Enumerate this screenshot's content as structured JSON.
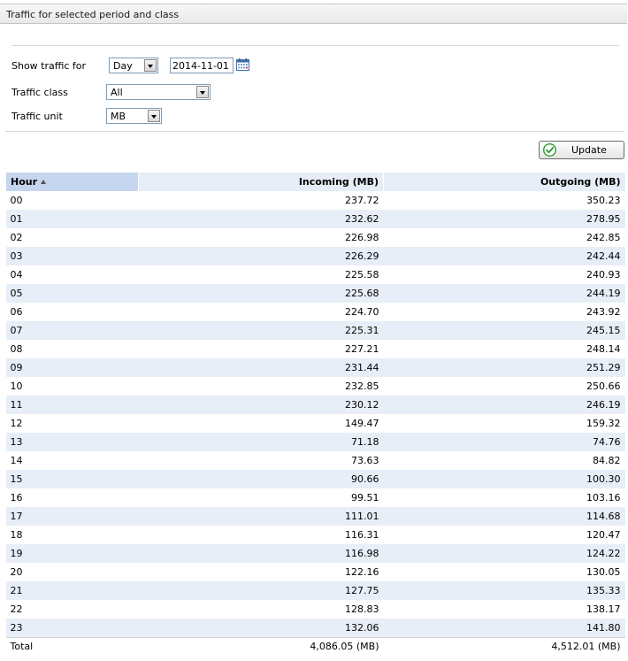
{
  "header": {
    "title": "Traffic for selected period and class"
  },
  "form": {
    "show_traffic_for": {
      "label": "Show traffic for",
      "period": "Day",
      "date": "2014-11-01"
    },
    "traffic_class": {
      "label": "Traffic class",
      "value": "All"
    },
    "traffic_unit": {
      "label": "Traffic unit",
      "value": "MB"
    }
  },
  "update_button": {
    "label": "Update"
  },
  "table": {
    "columns": [
      "Hour",
      "Incoming (MB)",
      "Outgoing (MB)"
    ],
    "sort_column": "Hour",
    "sort_direction": "ascending",
    "rows": [
      [
        "00",
        "237.72",
        "350.23"
      ],
      [
        "01",
        "232.62",
        "278.95"
      ],
      [
        "02",
        "226.98",
        "242.85"
      ],
      [
        "03",
        "226.29",
        "242.44"
      ],
      [
        "04",
        "225.58",
        "240.93"
      ],
      [
        "05",
        "225.68",
        "244.19"
      ],
      [
        "06",
        "224.70",
        "243.92"
      ],
      [
        "07",
        "225.31",
        "245.15"
      ],
      [
        "08",
        "227.21",
        "248.14"
      ],
      [
        "09",
        "231.44",
        "251.29"
      ],
      [
        "10",
        "232.85",
        "250.66"
      ],
      [
        "11",
        "230.12",
        "246.19"
      ],
      [
        "12",
        "149.47",
        "159.32"
      ],
      [
        "13",
        "71.18",
        "74.76"
      ],
      [
        "14",
        "73.63",
        "84.82"
      ],
      [
        "15",
        "90.66",
        "100.30"
      ],
      [
        "16",
        "99.51",
        "103.16"
      ],
      [
        "17",
        "111.01",
        "114.68"
      ],
      [
        "18",
        "116.31",
        "120.47"
      ],
      [
        "19",
        "116.98",
        "124.22"
      ],
      [
        "20",
        "122.16",
        "130.05"
      ],
      [
        "21",
        "127.75",
        "135.33"
      ],
      [
        "22",
        "128.83",
        "138.17"
      ],
      [
        "23",
        "132.06",
        "141.80"
      ]
    ],
    "total": {
      "label": "Total",
      "incoming": "4,086.05 (MB)",
      "outgoing": "4,512.01 (MB)"
    }
  },
  "colors": {
    "row_alt": "#e8eef7",
    "header_bg": "#e6edf6",
    "sorted_header_bg": "#c6d6ee"
  }
}
